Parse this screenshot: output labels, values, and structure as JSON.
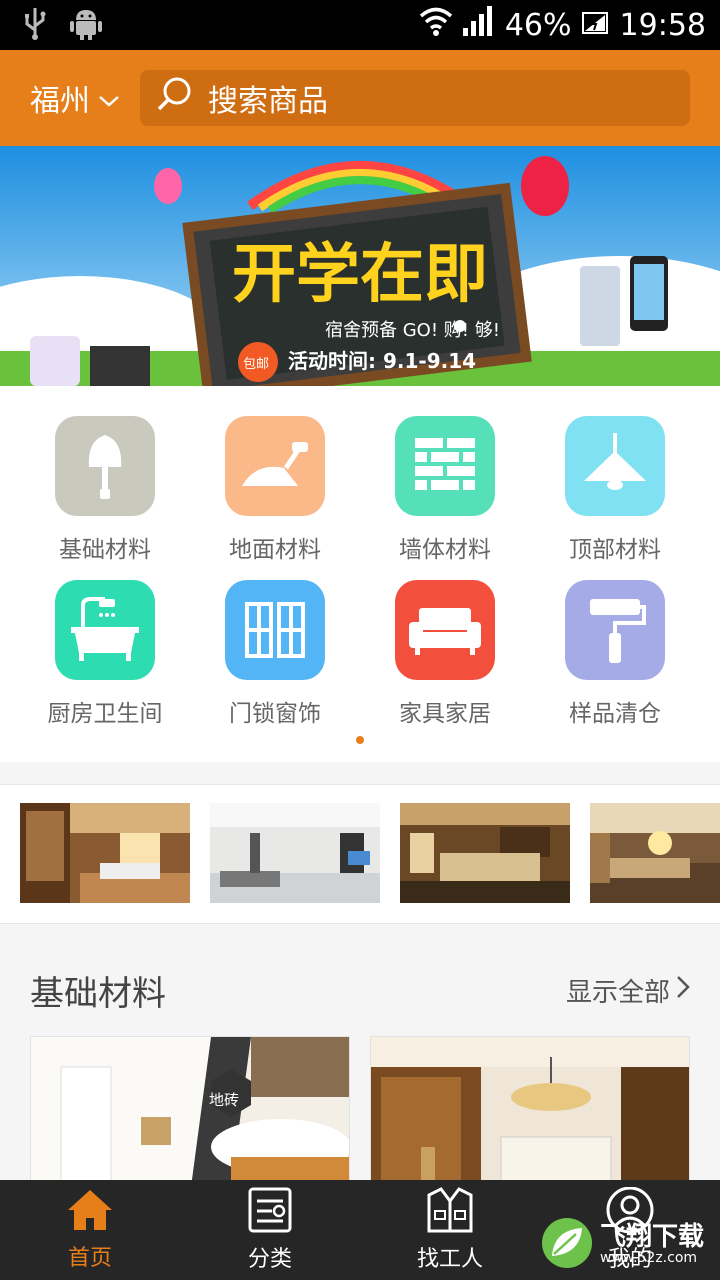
{
  "status_bar": {
    "battery": "46%",
    "time": "19:58"
  },
  "header": {
    "city": "福州",
    "search_placeholder": "搜索商品"
  },
  "banner": {
    "headline": "开学在即",
    "subline": "宿舍预备 GO! 购! 够!",
    "tag": "包邮",
    "date_text": "活动时间: 9.1-9.14"
  },
  "categories": [
    {
      "label": "基础材料",
      "icon": "trowel-icon",
      "color": "#c9c9bd"
    },
    {
      "label": "地面材料",
      "icon": "plaster-trowel-icon",
      "color": "#fbb98a"
    },
    {
      "label": "墙体材料",
      "icon": "brick-wall-icon",
      "color": "#55e0b9"
    },
    {
      "label": "顶部材料",
      "icon": "ceiling-lamp-icon",
      "color": "#7fe1f1"
    },
    {
      "label": "厨房卫生间",
      "icon": "bathtub-icon",
      "color": "#2ddcb0"
    },
    {
      "label": "门锁窗饰",
      "icon": "window-icon",
      "color": "#54b5f6"
    },
    {
      "label": "家具家居",
      "icon": "sofa-icon",
      "color": "#f34f3d"
    },
    {
      "label": "样品清仓",
      "icon": "paint-roller-icon",
      "color": "#a4abe6"
    }
  ],
  "section": {
    "title": "基础材料",
    "more": "显示全部",
    "badge": "地砖"
  },
  "bottom_nav": [
    {
      "label": "首页",
      "icon": "home-icon",
      "active": true
    },
    {
      "label": "分类",
      "icon": "category-list-icon",
      "active": false
    },
    {
      "label": "找工人",
      "icon": "worker-vest-icon",
      "active": false
    },
    {
      "label": "我的",
      "icon": "user-icon",
      "active": false
    }
  ],
  "watermark": {
    "text": "飞翔下载",
    "url": "www.52z.com"
  },
  "colors": {
    "accent": "#e67e1a",
    "nav_bg": "#262626"
  }
}
